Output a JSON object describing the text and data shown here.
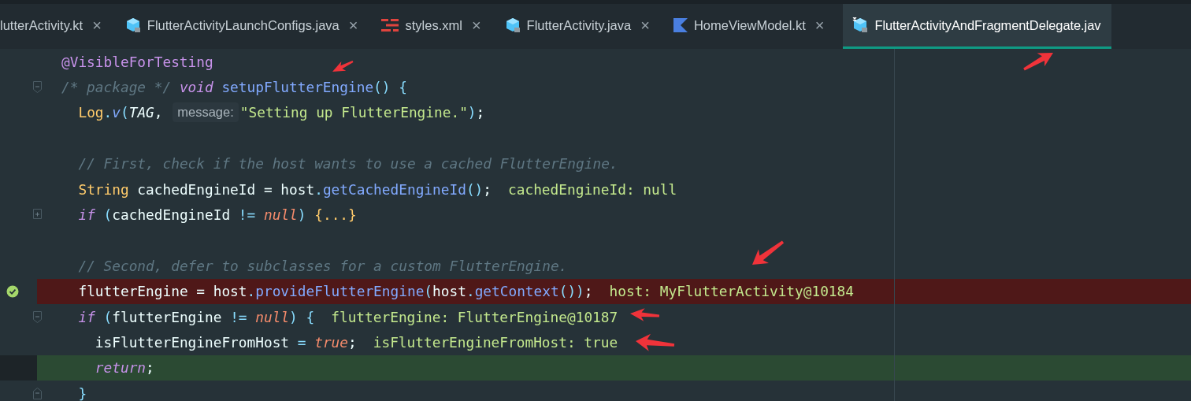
{
  "tabs": [
    {
      "label": "lutterActivity.kt",
      "kind": "plain",
      "selected": false,
      "closable": true
    },
    {
      "label": "FlutterActivityLaunchConfigs.java",
      "kind": "java",
      "selected": false,
      "closable": true
    },
    {
      "label": "styles.xml",
      "kind": "xml",
      "selected": false,
      "closable": true
    },
    {
      "label": "FlutterActivity.java",
      "kind": "java",
      "selected": false,
      "closable": true
    },
    {
      "label": "HomeViewModel.kt",
      "kind": "kotlin",
      "selected": false,
      "closable": true
    },
    {
      "label": "FlutterActivityAndFragmentDelegate.jav",
      "kind": "java_test",
      "selected": true,
      "closable": false
    }
  ],
  "close_glyph": "×",
  "lines": [
    {
      "kind": "code",
      "tokens": [
        {
          "kind": "annotation",
          "text": "@VisibleForTesting"
        }
      ]
    },
    {
      "kind": "code",
      "fold": {
        "kind": "start"
      },
      "tokens": [
        {
          "kind": "comment",
          "text": "/* package */"
        },
        {
          "kind": "keyword",
          "text": " void"
        },
        {
          "kind": "method",
          "text": " setupFlutterEngine"
        },
        {
          "kind": "punct",
          "text": "()"
        },
        {
          "kind": "punct",
          "text": " {"
        }
      ]
    },
    {
      "kind": "code",
      "tokens": [
        {
          "kind": "type",
          "text": "  Log"
        },
        {
          "kind": "punct",
          "text": "."
        },
        {
          "kind": "static",
          "text": "v"
        },
        {
          "kind": "punct",
          "text": "("
        },
        {
          "kind": "constant",
          "text": "TAG"
        },
        {
          "kind": "plain",
          "text": ", "
        },
        {
          "kind": "hint",
          "text": "message:"
        },
        {
          "kind": "string",
          "text": "\"Setting up FlutterEngine.\""
        },
        {
          "kind": "punct",
          "text": ")"
        },
        {
          "kind": "plain",
          "text": ";"
        }
      ]
    },
    {
      "kind": "blank"
    },
    {
      "kind": "code",
      "tokens": [
        {
          "kind": "comment",
          "text": "  // First, check if the host wants to use a cached FlutterEngine."
        }
      ]
    },
    {
      "kind": "code",
      "tokens": [
        {
          "kind": "type",
          "text": "  String"
        },
        {
          "kind": "plain",
          "text": " cachedEngineId = host"
        },
        {
          "kind": "punct",
          "text": "."
        },
        {
          "kind": "method",
          "text": "getCachedEngineId"
        },
        {
          "kind": "punct",
          "text": "()"
        },
        {
          "kind": "plain",
          "text": ";"
        },
        {
          "kind": "value",
          "text": "cachedEngineId: null"
        }
      ]
    },
    {
      "kind": "code",
      "fold": {
        "kind": "collapsed"
      },
      "tokens": [
        {
          "kind": "keyword",
          "text": "  if"
        },
        {
          "kind": "punct",
          "text": " ("
        },
        {
          "kind": "plain",
          "text": "cachedEngineId "
        },
        {
          "kind": "punct",
          "text": "!="
        },
        {
          "kind": "literal",
          "text": " null"
        },
        {
          "kind": "punct",
          "text": ")"
        },
        {
          "kind": "folded",
          "text": " {...}"
        }
      ]
    },
    {
      "kind": "blank"
    },
    {
      "kind": "code",
      "tokens": [
        {
          "kind": "comment",
          "text": "  // Second, defer to subclasses for a custom FlutterEngine."
        }
      ]
    },
    {
      "kind": "breakpoint",
      "gutter": {
        "kind": "verified_breakpoint"
      },
      "tokens": [
        {
          "kind": "plain",
          "text": "  flutterEngine = host"
        },
        {
          "kind": "punct",
          "text": "."
        },
        {
          "kind": "method",
          "text": "provideFlutterEngine"
        },
        {
          "kind": "punct",
          "text": "("
        },
        {
          "kind": "plain",
          "text": "host"
        },
        {
          "kind": "punct",
          "text": "."
        },
        {
          "kind": "method",
          "text": "getContext"
        },
        {
          "kind": "punct",
          "text": "())"
        },
        {
          "kind": "plain",
          "text": ";"
        },
        {
          "kind": "value",
          "text": "host: MyFlutterActivity@10184"
        }
      ]
    },
    {
      "kind": "code",
      "fold": {
        "kind": "start"
      },
      "tokens": [
        {
          "kind": "keyword",
          "text": "  if"
        },
        {
          "kind": "punct",
          "text": " ("
        },
        {
          "kind": "plain",
          "text": "flutterEngine "
        },
        {
          "kind": "punct",
          "text": "!="
        },
        {
          "kind": "literal",
          "text": " null"
        },
        {
          "kind": "punct",
          "text": ")"
        },
        {
          "kind": "punct",
          "text": " {"
        },
        {
          "kind": "value",
          "text": "flutterEngine: FlutterEngine@10187"
        }
      ]
    },
    {
      "kind": "code",
      "tokens": [
        {
          "kind": "plain",
          "text": "    isFlutterEngineFromHost "
        },
        {
          "kind": "punct",
          "text": "="
        },
        {
          "kind": "literal",
          "text": " true"
        },
        {
          "kind": "plain",
          "text": ";"
        },
        {
          "kind": "value",
          "text": "isFlutterEngineFromHost: true"
        }
      ]
    },
    {
      "kind": "execution",
      "tokens": [
        {
          "kind": "keyword",
          "text": "    return"
        },
        {
          "kind": "plain",
          "text": ";"
        }
      ]
    },
    {
      "kind": "code",
      "fold": {
        "kind": "end"
      },
      "tokens": [
        {
          "kind": "punct",
          "text": "  }"
        }
      ]
    }
  ]
}
